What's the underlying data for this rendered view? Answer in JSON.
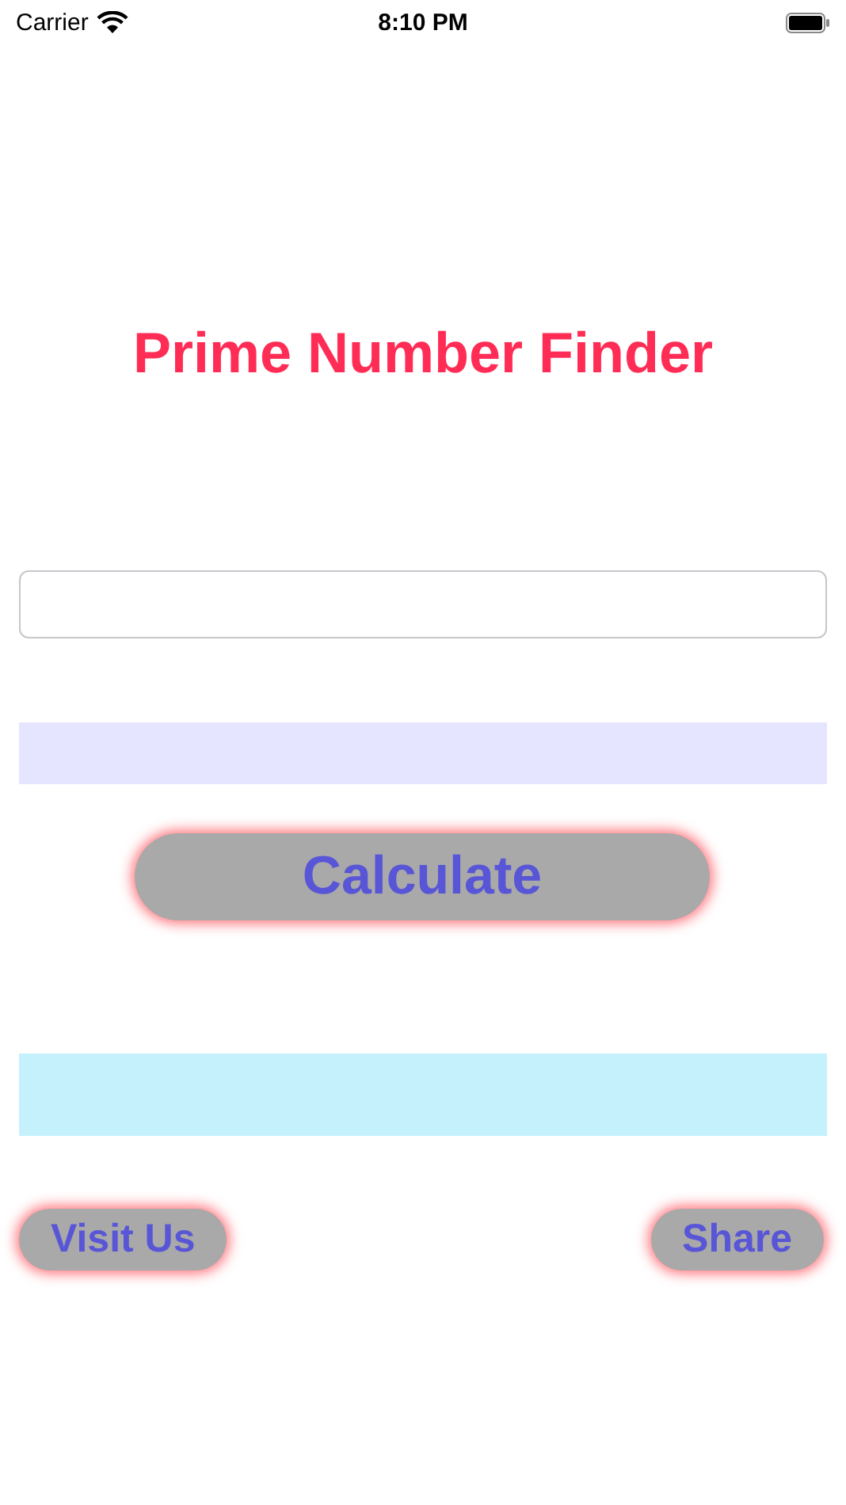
{
  "status_bar": {
    "carrier": "Carrier",
    "time": "8:10 PM"
  },
  "title": "Prime Number Finder",
  "calculate_button": {
    "label": "Calculate"
  },
  "footer_buttons": [
    {
      "label": "Visit Us"
    },
    {
      "label": "Share"
    }
  ]
}
